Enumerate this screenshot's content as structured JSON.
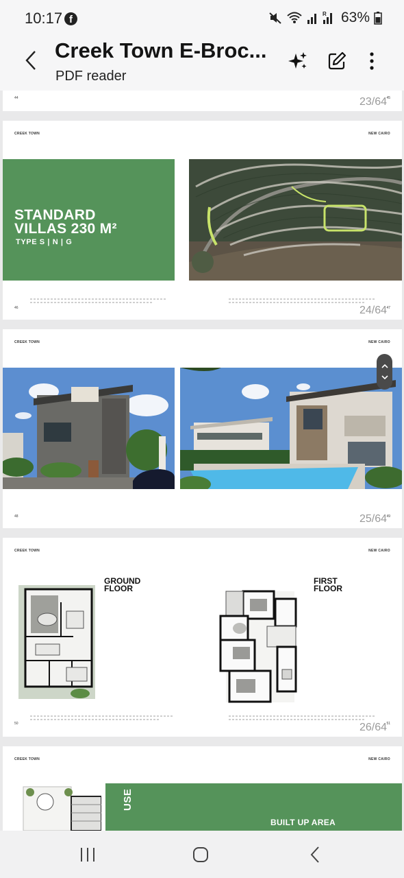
{
  "status_bar": {
    "time": "10:17",
    "battery": "63%",
    "icons": [
      "facebook-icon",
      "mute-icon",
      "wifi-icon",
      "signal-icon",
      "signal-roaming-icon",
      "battery-icon"
    ]
  },
  "header": {
    "title": "Creek Town E-Broc...",
    "subtitle": "PDF reader",
    "icons": [
      "back-icon",
      "ai-sparkle-icon",
      "edit-icon",
      "more-vert-icon"
    ]
  },
  "pages": [
    {
      "indicator": "23/64",
      "left_num": "44",
      "right_num": "45"
    },
    {
      "indicator": "24/64",
      "left_header": "CREEK TOWN",
      "right_header": "NEW CAIRO",
      "heading_line1": "STANDARD",
      "heading_line2": "VILLAS 230 M²",
      "type_label": "TYPE S | N | G",
      "left_num": "46",
      "right_num": "47"
    },
    {
      "indicator": "25/64",
      "left_header": "CREEK TOWN",
      "right_header": "NEW CAIRO",
      "left_num": "48",
      "right_num": "49"
    },
    {
      "indicator": "26/64",
      "left_header": "CREEK TOWN",
      "right_header": "NEW CAIRO",
      "ground_floor_1": "GROUND",
      "ground_floor_2": "FLOOR",
      "first_floor_1": "FIRST",
      "first_floor_2": "FLOOR",
      "left_num": "50",
      "right_num": "51"
    },
    {
      "left_header": "CREEK TOWN",
      "right_header": "NEW CAIRO",
      "vertical_text": "USE",
      "built_up_label": "BUILT UP AREA"
    }
  ],
  "colors": {
    "brand_green": "#55935a",
    "page_bg": "#ffffff",
    "viewer_bg": "#e9e9ea"
  },
  "nav": {
    "icons": [
      "recents-icon",
      "home-icon",
      "back-nav-icon"
    ]
  }
}
